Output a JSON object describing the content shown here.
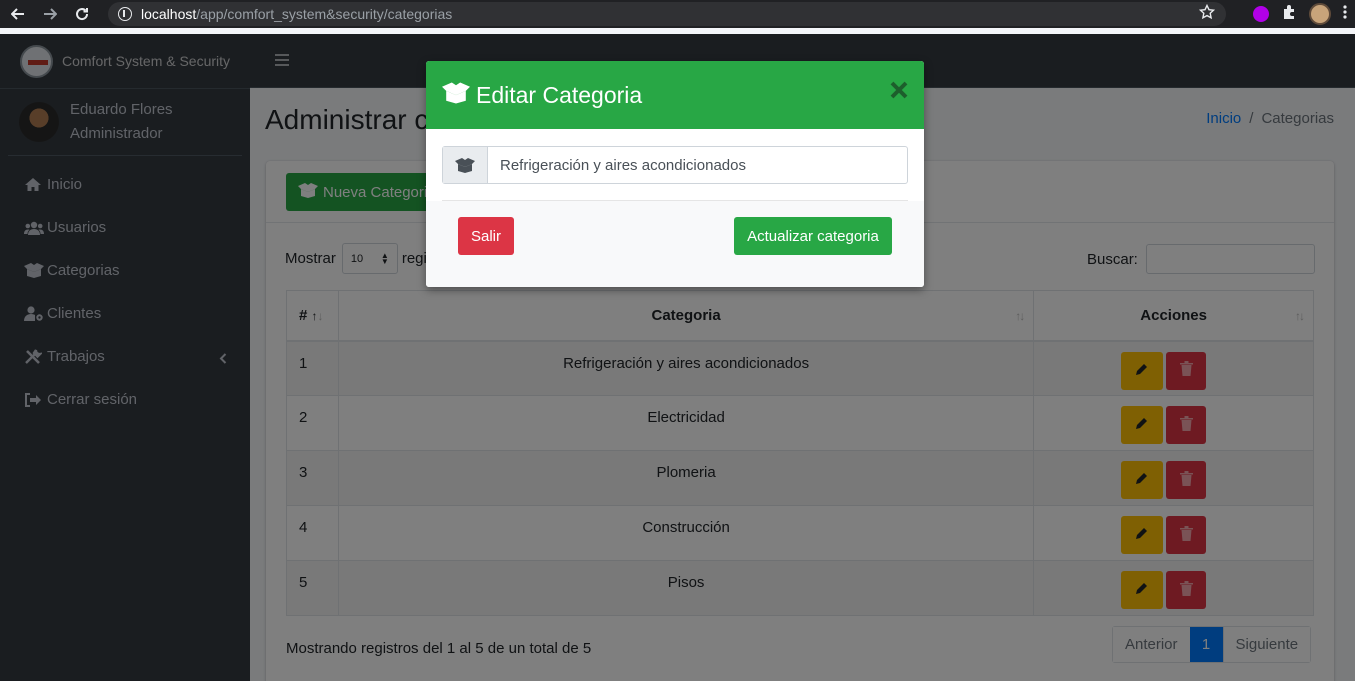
{
  "browser": {
    "url_host": "localhost",
    "url_path": "/app/comfort_system&security/categorias"
  },
  "sidebar": {
    "brand": "Comfort System & Security",
    "user": {
      "name": "Eduardo Flores",
      "role": "Administrador"
    },
    "items": [
      {
        "label": "Inicio",
        "icon": "home-icon"
      },
      {
        "label": "Usuarios",
        "icon": "users-icon"
      },
      {
        "label": "Categorias",
        "icon": "box-open-icon"
      },
      {
        "label": "Clientes",
        "icon": "user-cog-icon"
      },
      {
        "label": "Trabajos",
        "icon": "tools-icon"
      },
      {
        "label": "Cerrar sesión",
        "icon": "sign-out-icon"
      }
    ]
  },
  "page": {
    "title": "Administrar c",
    "breadcrumb": {
      "home": "Inicio",
      "separator": "/",
      "current": "Categorias"
    }
  },
  "card": {
    "new_button": "Nueva Categoria",
    "show_label": "Mostrar",
    "show_value": "10",
    "show_suffix": "regis",
    "search_label": "Buscar:",
    "info": "Mostrando registros del 1 al 5 de un total de 5"
  },
  "table": {
    "headers": {
      "num": "#",
      "category": "Categoria",
      "actions": "Acciones"
    },
    "rows": [
      {
        "num": "1",
        "category": "Refrigeración y aires acondicionados"
      },
      {
        "num": "2",
        "category": "Electricidad"
      },
      {
        "num": "3",
        "category": "Plomeria"
      },
      {
        "num": "4",
        "category": "Construcción"
      },
      {
        "num": "5",
        "category": "Pisos"
      }
    ]
  },
  "pagination": {
    "prev": "Anterior",
    "current": "1",
    "next": "Siguiente"
  },
  "modal": {
    "title": "Editar Categoria",
    "input_value": "Refrigeración y aires acondicionados",
    "cancel": "Salir",
    "submit": "Actualizar categoria"
  },
  "colors": {
    "primary": "#007bff",
    "success": "#28a745",
    "danger": "#dc3545",
    "warning": "#ffc107",
    "sidebar": "#343a40"
  }
}
